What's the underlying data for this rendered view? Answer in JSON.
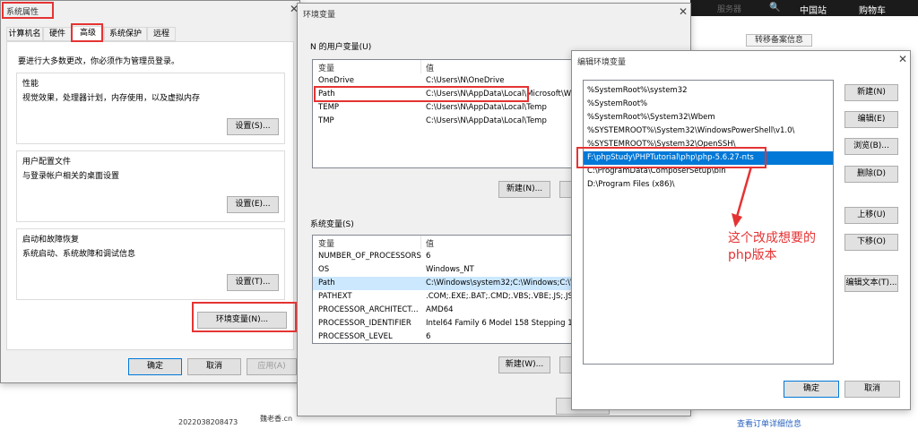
{
  "background": {
    "server_text": "服务器",
    "nav": [
      "中国站",
      "购物车"
    ],
    "transfer_btn": "转移备案信息",
    "order_no": "2022038208473",
    "name_frag": "魏老香.cn",
    "link": "查看订单详细信息"
  },
  "sysprops": {
    "title": "系统属性",
    "tabs": [
      "计算机名",
      "硬件",
      "高级",
      "系统保护",
      "远程"
    ],
    "admin_note": "要进行大多数更改，你必须作为管理员登录。",
    "perf": {
      "title": "性能",
      "desc": "视觉效果，处理器计划，内存使用，以及虚拟内存",
      "btn": "设置(S)..."
    },
    "profile": {
      "title": "用户配置文件",
      "desc": "与登录帐户相关的桌面设置",
      "btn": "设置(E)..."
    },
    "startup": {
      "title": "启动和故障恢复",
      "desc": "系统启动、系统故障和调试信息",
      "btn": "设置(T)..."
    },
    "env_btn": "环境变量(N)...",
    "ok": "确定",
    "cancel": "取消",
    "apply": "应用(A)"
  },
  "envvars": {
    "title": "环境变量",
    "user_section": "N 的用户变量(U)",
    "col_var": "变量",
    "col_val": "值",
    "user_vars": [
      {
        "name": "OneDrive",
        "value": "C:\\Users\\N\\OneDrive"
      },
      {
        "name": "Path",
        "value": "C:\\Users\\N\\AppData\\Local\\Microsoft\\W"
      },
      {
        "name": "TEMP",
        "value": "C:\\Users\\N\\AppData\\Local\\Temp"
      },
      {
        "name": "TMP",
        "value": "C:\\Users\\N\\AppData\\Local\\Temp"
      }
    ],
    "new_user": "新建(N)...",
    "sys_section": "系统变量(S)",
    "sys_vars": [
      {
        "name": "NUMBER_OF_PROCESSORS",
        "value": "6"
      },
      {
        "name": "OS",
        "value": "Windows_NT"
      },
      {
        "name": "Path",
        "value": "C:\\Windows\\system32;C:\\Windows;C:\\W"
      },
      {
        "name": "PATHEXT",
        "value": ".COM;.EXE;.BAT;.CMD;.VBS;.VBE;.JS;.JSE"
      },
      {
        "name": "PROCESSOR_ARCHITECT...",
        "value": "AMD64"
      },
      {
        "name": "PROCESSOR_IDENTIFIER",
        "value": "Intel64 Family 6 Model 158 Stepping 10"
      },
      {
        "name": "PROCESSOR_LEVEL",
        "value": "6"
      }
    ],
    "new_sys": "新建(W)..."
  },
  "editenv": {
    "title": "编辑环境变量",
    "paths": [
      "%SystemRoot%\\system32",
      "%SystemRoot%",
      "%SystemRoot%\\System32\\Wbem",
      "%SYSTEMROOT%\\System32\\WindowsPowerShell\\v1.0\\",
      "%SYSTEMROOT%\\System32\\OpenSSH\\",
      "F:\\phpStudy\\PHPTutorial\\php\\php-5.6.27-nts",
      "C:\\ProgramData\\ComposerSetup\\bin",
      "D:\\Program Files (x86)\\"
    ],
    "selected_index": 5,
    "buttons": [
      "新建(N)",
      "编辑(E)",
      "浏览(B)...",
      "删除(D)",
      "上移(U)",
      "下移(O)",
      "编辑文本(T)..."
    ],
    "ok": "确定",
    "cancel": "取消"
  },
  "annotation": {
    "line1": "这个改成想要的",
    "line2": "php版本",
    "color": "#e53333"
  }
}
